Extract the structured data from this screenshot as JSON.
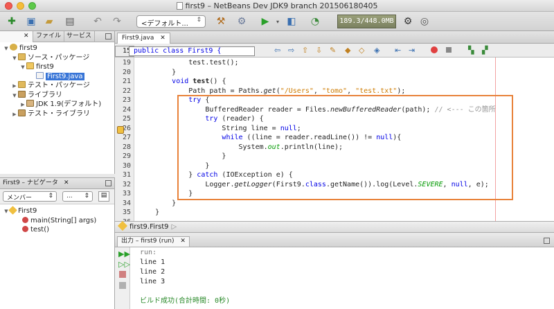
{
  "window": {
    "title": "first9 – NetBeans Dev JDK9 branch 201506180405"
  },
  "toolbar": {
    "config": "<デフォルト...",
    "memory": "189.3/448.0MB"
  },
  "projects_panel": {
    "tabs": [
      "ファイル",
      "サービス"
    ],
    "tree": [
      {
        "label": "first9",
        "level": 0,
        "icon": "project-icon",
        "expanded": true
      },
      {
        "label": "ソース・パッケージ",
        "level": 1,
        "icon": "package-folder-icon",
        "expanded": true
      },
      {
        "label": "first9",
        "level": 2,
        "icon": "package-icon",
        "expanded": true
      },
      {
        "label": "First9.java",
        "level": 3,
        "icon": "java-file-icon",
        "selected": true
      },
      {
        "label": "テスト・パッケージ",
        "level": 1,
        "icon": "package-folder-icon",
        "expanded": false
      },
      {
        "label": "ライブラリ",
        "level": 1,
        "icon": "library-icon",
        "expanded": true
      },
      {
        "label": "JDK 1.9(デフォルト)",
        "level": 2,
        "icon": "jdk-icon",
        "expanded": false
      },
      {
        "label": "テスト・ライブラリ",
        "level": 1,
        "icon": "library-icon",
        "expanded": false
      }
    ]
  },
  "navigator": {
    "title": "First9 – ナビゲータ",
    "members_select": "メンバー",
    "other_select": "...",
    "items": [
      {
        "label": "First9",
        "level": 0
      },
      {
        "label": "main(String[] args)",
        "level": 1
      },
      {
        "label": "test()",
        "level": 1
      }
    ]
  },
  "editor": {
    "tab": "First9.java",
    "sticky_line_number": "15",
    "sticky_line": "public class First9 {",
    "line_numbers": [
      "19",
      "20",
      "21",
      "22",
      "23",
      "24",
      "25",
      "26",
      "27",
      "28",
      "29",
      "30",
      "31",
      "32",
      "33",
      "34",
      "35",
      "36"
    ],
    "breadcrumb": "first9.First9"
  },
  "output": {
    "tab": "出力 – first9 (run)",
    "lines": [
      "run:",
      "line 1",
      "line 2",
      "line 3",
      "",
      "ビルド成功(合計時間: 0秒)"
    ]
  }
}
